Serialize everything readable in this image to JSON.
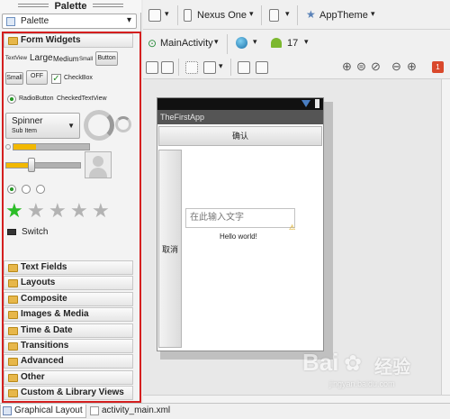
{
  "palette": {
    "title": "Palette",
    "dropdown_value": "Palette",
    "active_category": "Form Widgets",
    "widgets": {
      "textview": "TextView",
      "large": "Large",
      "medium": "Medium",
      "small": "Small",
      "button": "Button",
      "small_button": "Small",
      "off_toggle": "OFF",
      "checkbox": "CheckBox",
      "radio": "RadioButton",
      "checked_textview": "CheckedTextView",
      "spinner": "Spinner",
      "spinner_sub": "Sub Item",
      "switch": "Switch",
      "rating_stars_filled": 1,
      "rating_stars_total": 5
    },
    "categories": [
      "Text Fields",
      "Layouts",
      "Composite",
      "Images & Media",
      "Time & Date",
      "Transitions",
      "Advanced",
      "Other",
      "Custom & Library Views"
    ]
  },
  "toolbar": {
    "device": "Nexus One",
    "theme": "AppTheme",
    "activity": "MainActivity",
    "api_level": "17"
  },
  "device_preview": {
    "app_title": "TheFirstApp",
    "confirm_button": "确认",
    "cancel_button": "取消",
    "input_placeholder": "在此输入文字",
    "hello_text": "Hello world!"
  },
  "tabs": [
    {
      "label": "Graphical Layout",
      "icon": "layout-icon"
    },
    {
      "label": "activity_main.xml",
      "icon": "xml-file-icon"
    }
  ],
  "watermark": {
    "brand": "Bai",
    "brand_suffix": "经验",
    "url": "jingyan.baidu.com"
  },
  "colors": {
    "highlight_border": "#d41f1f",
    "android_green": "#7cb82f",
    "star_green": "#2bbd27",
    "progress_yellow": "#f2b800"
  }
}
